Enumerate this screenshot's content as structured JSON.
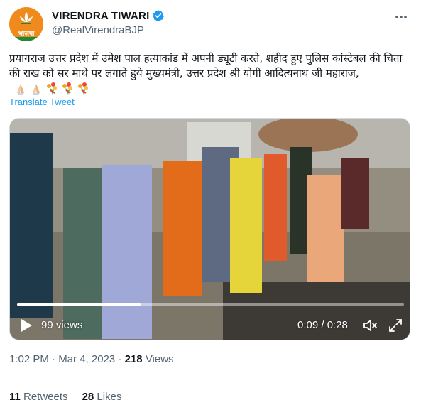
{
  "author": {
    "display_name": "VIRENDRA TIWARI",
    "handle": "@RealVirendraBJP",
    "avatar_text": "भाजपा",
    "verified": true
  },
  "tweet": {
    "text": "प्रयागराज उत्तर प्रदेश में उमेश पाल हत्याकांड में अपनी ड्यूटी करते, शहीद हुए पुलिस कांस्टेबल की चिता की राख को सर माथे पर लगाते हुये मुख्यमंत्री, उत्तर प्रदेश श्री योगी आदित्यनाथ जी महाराज,",
    "emojis": [
      "folded-hands-icon",
      "folded-hands-icon",
      "bouquet-icon",
      "bouquet-icon",
      "bouquet-icon"
    ],
    "translate_label": "Translate Tweet"
  },
  "video": {
    "views": "99 views",
    "time": "0:09 / 0:28",
    "progress_fraction": 0.32
  },
  "meta": {
    "time": "1:02 PM",
    "date": "Mar 4, 2023",
    "views_count": "218",
    "views_label": "Views"
  },
  "stats": {
    "retweets_count": "11",
    "retweets_label": "Retweets",
    "likes_count": "28",
    "likes_label": "Likes"
  },
  "colors": {
    "accent": "#1d9bf0",
    "secondary_text": "#536471",
    "avatar_bg": "#f08a1c"
  }
}
